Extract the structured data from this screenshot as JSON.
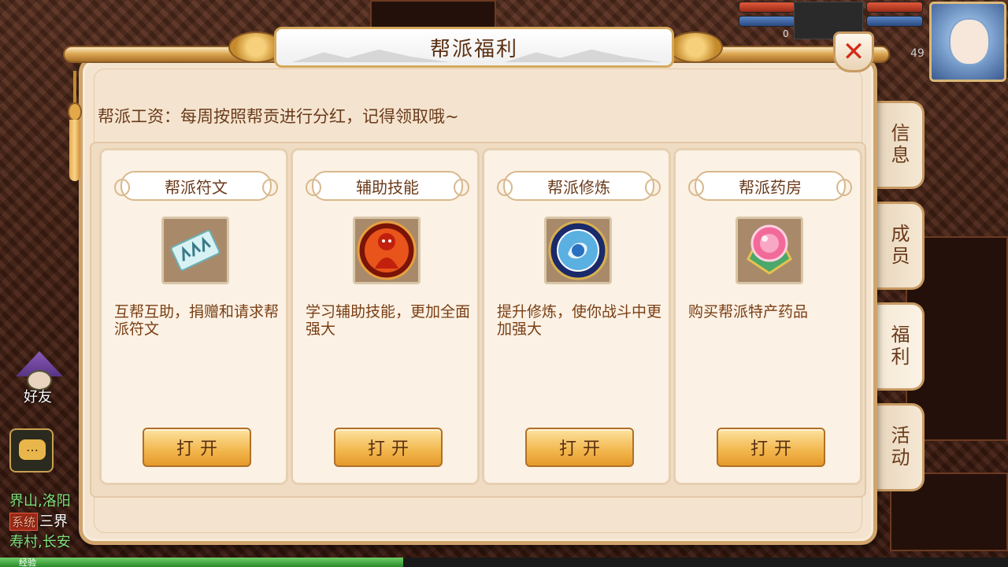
{
  "panel": {
    "title": "帮派福利",
    "notice": "帮派工资：每周按照帮贡进行分红，记得领取哦~",
    "close_symbol": "✕"
  },
  "cards": [
    {
      "title": "帮派符文",
      "icon": "rune-scroll-icon",
      "description": "互帮互助，捐赠和请求帮派符文",
      "button": "打开"
    },
    {
      "title": "辅助技能",
      "icon": "fire-skill-icon",
      "description": "学习辅助技能，更加全面强大",
      "button": "打开"
    },
    {
      "title": "帮派修炼",
      "icon": "cultivation-orb-icon",
      "description": "提升修炼，使你战斗中更加强大",
      "button": "打开"
    },
    {
      "title": "帮派药房",
      "icon": "pharmacy-gem-icon",
      "description": "购买帮派特产药品",
      "button": "打开"
    }
  ],
  "tabs": [
    {
      "label": "信息",
      "active": false
    },
    {
      "label": "成员",
      "active": false
    },
    {
      "label": "福利",
      "active": true
    },
    {
      "label": "活动",
      "active": false
    }
  ],
  "hud": {
    "left_bar_value": "0",
    "level": "49"
  },
  "social": {
    "friend_label": "好友",
    "chat_icon": "…",
    "chat_lines": [
      {
        "tag": "",
        "text": "界山,洛阳",
        "color": "#7ee07a"
      },
      {
        "tag": "系统",
        "text": "三界",
        "color": "#ffffff"
      },
      {
        "tag": "",
        "text": "寿村,长安",
        "color": "#7ee07a"
      }
    ],
    "exp_label": "经验",
    "exp_progress": 0.4
  }
}
